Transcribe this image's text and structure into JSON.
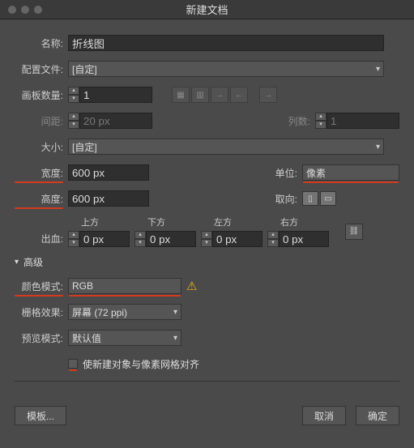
{
  "title": "新建文档",
  "labels": {
    "name": "名称:",
    "profile": "配置文件:",
    "artboards": "画板数量:",
    "spacing": "间距:",
    "columns": "列数:",
    "size": "大小:",
    "width": "宽度:",
    "units": "单位:",
    "height": "高度:",
    "orient": "取向:",
    "bleed": "出血:",
    "top": "上方",
    "bottom": "下方",
    "left": "左方",
    "right": "右方",
    "advanced": "高级",
    "colorMode": "颜色模式:",
    "rasterFx": "栅格效果:",
    "preview": "预览模式:",
    "alignGrid": "使新建对象与像素网格对齐"
  },
  "values": {
    "name": "折线图",
    "profile": "[自定]",
    "artboards": "1",
    "spacing": "20 px",
    "columns": "1",
    "size": "[自定]",
    "width": "600 px",
    "height": "600 px",
    "units": "像素",
    "bleedTop": "0 px",
    "bleedBottom": "0 px",
    "bleedLeft": "0 px",
    "bleedRight": "0 px",
    "colorMode": "RGB",
    "rasterFx": "屏幕 (72 ppi)",
    "preview": "默认值"
  },
  "buttons": {
    "template": "模板...",
    "cancel": "取消",
    "ok": "确定"
  }
}
